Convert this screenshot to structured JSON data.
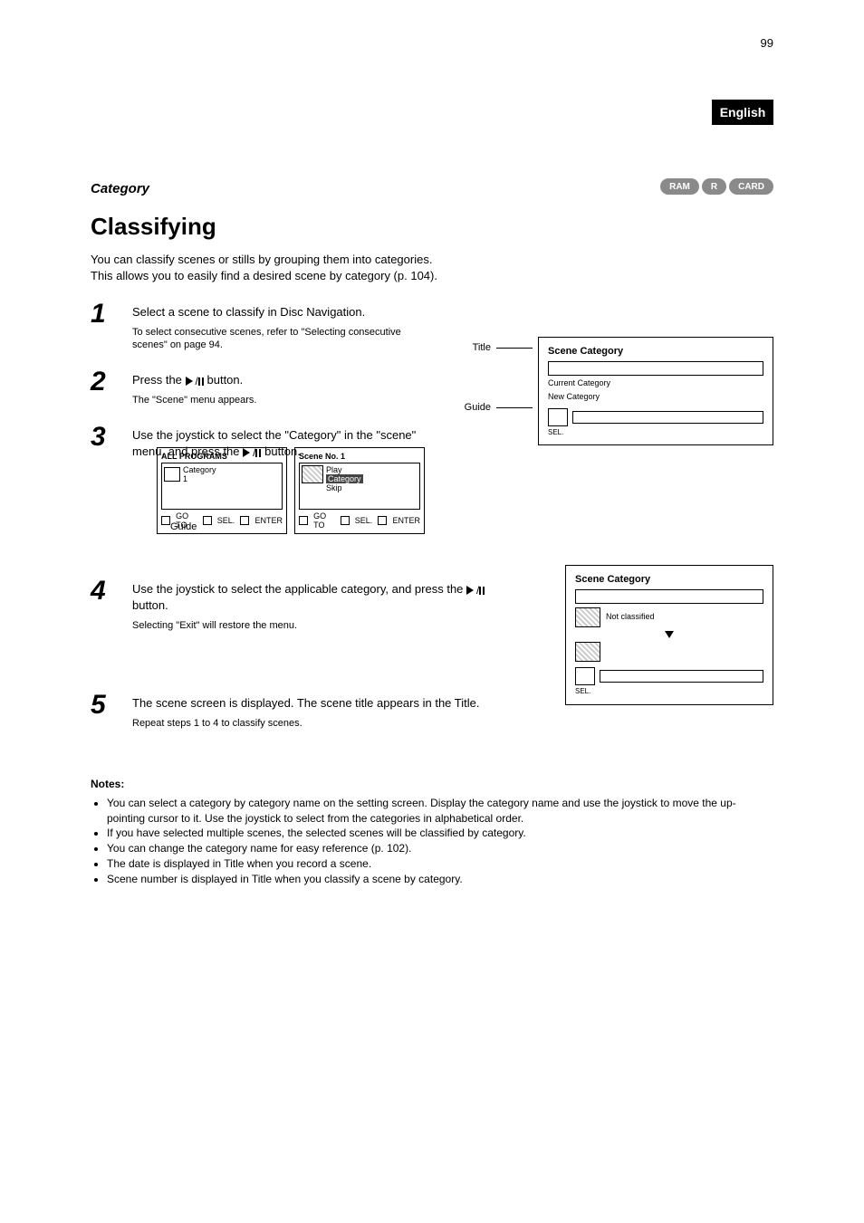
{
  "page_number": "99",
  "section_tab": "English",
  "pill_labels": {
    "ram": "RAM",
    "r": "R",
    "card": "CARD"
  },
  "category": "Category",
  "title": "Classifying",
  "intro": "You can classify scenes or stills by grouping them into categories. This allows you to easily find a desired scene by category (p. 104).",
  "steps": {
    "s1": {
      "text": "Select a scene to classify in Disc Navigation.",
      "hint": "To select consecutive scenes, refer to \"Selecting consecutive scenes\" on page 94."
    },
    "s2": {
      "label_prefix": "Press the ",
      "label_suffix": " button.",
      "hint": "The \"Scene\" menu appears."
    },
    "s3": {
      "text": "Use the joystick to select the \"Category\" in the \"scene\" menu, and press the ",
      "button": " button."
    },
    "s4": {
      "text": "Use the joystick to select the applicable category, and press the ",
      "button": " button.",
      "hint": "Selecting \"Exit\" will restore the menu."
    },
    "s5": {
      "text": "The scene screen is displayed. The scene title appears in the Title.",
      "hint": "Repeat steps 1 to 4 to classify scenes."
    }
  },
  "fig_topright": {
    "label_title": "Title",
    "label_guide": "Guide",
    "box_title": "Scene Category",
    "line_a": "Current Category",
    "line_b": "New Category",
    "foot": "SEL."
  },
  "mini_screens": {
    "left": {
      "hdr": "ALL PROGRAMS",
      "body_line1": "Category",
      "body_line2": "1",
      "foot_go": "GO TO",
      "foot_sel": "SEL.",
      "foot_body": "ENTER"
    },
    "right": {
      "hdr": "Scene No. 1",
      "body_line1": "Play",
      "body_line2": "Category",
      "body_line3": "Skip",
      "foot_go": "GO TO",
      "foot_sel": "SEL.",
      "foot_body": "ENTER"
    },
    "guide": "Guide"
  },
  "fig_midright": {
    "title": "Scene Category",
    "upper_label": "Not classified",
    "lower_label": "",
    "foot": "SEL."
  },
  "notes": {
    "heading": "Notes:",
    "items": [
      "You can select a category by category name on the setting screen. Display the category name and use the joystick to move the up-pointing cursor to it. Use the joystick to select from the categories in alphabetical order.",
      "If you have selected multiple scenes, the selected scenes will be classified by category.",
      "You can change the category name for easy reference (p. 102).",
      "The date is displayed in Title when you record a scene.",
      "Scene number is displayed in Title when you classify a scene by category."
    ]
  }
}
